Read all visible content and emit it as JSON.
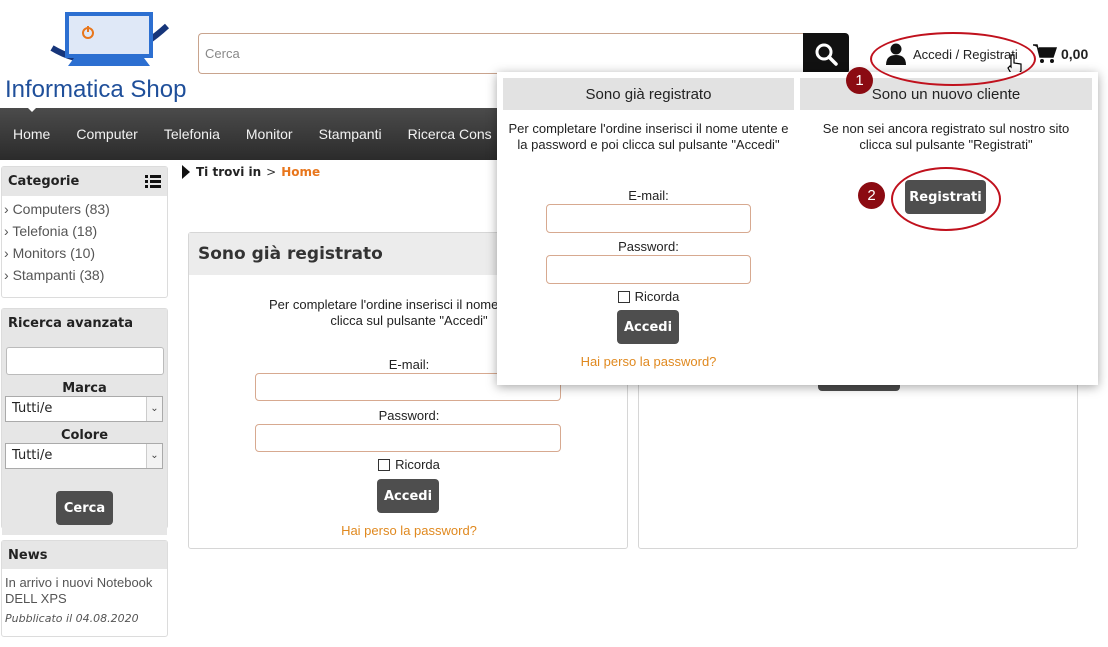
{
  "header": {
    "logo_text": "Informatica Shop",
    "search_placeholder": "Cerca",
    "account_label": "Accedi / Registrati",
    "cart_total": "0,00"
  },
  "annotations": {
    "badge1": "1",
    "badge2": "2"
  },
  "nav": {
    "items": [
      "Home",
      "Computer",
      "Telefonia",
      "Monitor",
      "Stampanti",
      "Ricerca Cons"
    ]
  },
  "sidebar": {
    "categories_title": "Categorie",
    "categories": [
      "Computers (83)",
      "Telefonia (18)",
      "Monitors (10)",
      "Stampanti (38)"
    ],
    "advanced_title": "Ricerca avanzata",
    "brand_label": "Marca",
    "brand_value": "Tutti/e",
    "color_label": "Colore",
    "color_value": "Tutti/e",
    "search_button": "Cerca",
    "news_title": "News",
    "news_text": "In arrivo i nuovi Notebook DELL XPS",
    "news_date": "Pubblicato il 04.08.2020"
  },
  "breadcrumb": {
    "prefix": "Ti trovi in",
    "sep": ">",
    "home": "Home"
  },
  "login_panel": {
    "title": "Sono già registrato",
    "intro_line1": "Per completare l'ordine inserisci il nome utente e",
    "intro_line2": "clicca sul pulsante \"Accedi\"",
    "email_label": "E-mail:",
    "password_label": "Password:",
    "remember_label": "Ricorda",
    "login_button": "Accedi",
    "forgot_link": "Hai perso la password?"
  },
  "dropdown": {
    "registered_title": "Sono già registrato",
    "registered_text": "Per completare l'ordine inserisci il nome utente e la password e poi clicca sul pulsante \"Accedi\"",
    "email_label": "E-mail:",
    "password_label": "Password:",
    "remember_label": "Ricorda",
    "login_button": "Accedi",
    "forgot_link": "Hai perso la password?",
    "new_title": "Sono un nuovo cliente",
    "new_text": "Se non sei ancora registrato sul nostro sito clicca sul pulsante \"Registrati\"",
    "register_button": "Registrati"
  },
  "colors": {
    "accent": "#e0891f",
    "annotation": "#c0111d",
    "nav_bg": "#333333",
    "brand": "#1f4f9a"
  }
}
